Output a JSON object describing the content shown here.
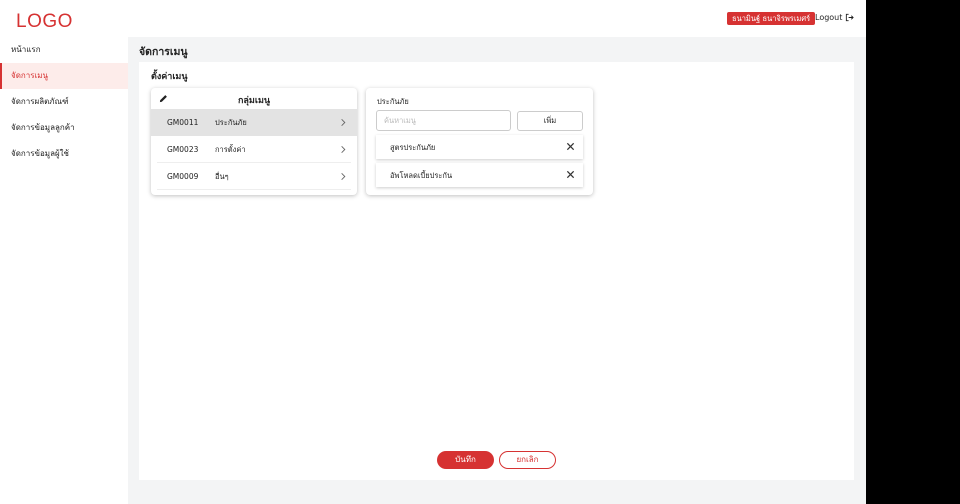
{
  "header": {
    "logo": "LOGO",
    "user_name": "ธนามินฐ์ ธนาจิรพรเมศร์",
    "logout_label": "Logout",
    "logout_icon": "logout-icon"
  },
  "sidebar": {
    "items": [
      {
        "label": "หน้าแรก",
        "active": false
      },
      {
        "label": "จัดการเมนู",
        "active": true
      },
      {
        "label": "จัดการผลิตภัณฑ์",
        "active": false
      },
      {
        "label": "จัดการข้อมูลลูกค้า",
        "active": false
      },
      {
        "label": "จัดการข้อมูลผู้ใช้",
        "active": false
      }
    ]
  },
  "page": {
    "title": "จัดการเมนู",
    "section_title": "ตั้งค่าเมนู"
  },
  "groups": {
    "title": "กลุ่มเมนู",
    "edit_icon": "pencil-icon",
    "rows": [
      {
        "code": "GM0011",
        "name": "ประกันภัย",
        "selected": true
      },
      {
        "code": "GM0023",
        "name": "การตั้งค่า",
        "selected": false
      },
      {
        "code": "GM0009",
        "name": "อื่นๆ",
        "selected": false
      }
    ]
  },
  "detail": {
    "title": "ประกันภัย",
    "search_placeholder": "ค้นหาเมนู",
    "search_value": "",
    "add_label": "เพิ่ม",
    "items": [
      {
        "label": "สูตรประกันภัย"
      },
      {
        "label": "อัพโหลดเบี้ยประกัน"
      }
    ]
  },
  "actions": {
    "save_label": "บันทึก",
    "cancel_label": "ยกเลิก"
  },
  "colors": {
    "accent": "#d63232",
    "active_bg": "#fdecea",
    "main_bg": "#f3f4f5",
    "selected_row": "#e3e3e3"
  }
}
